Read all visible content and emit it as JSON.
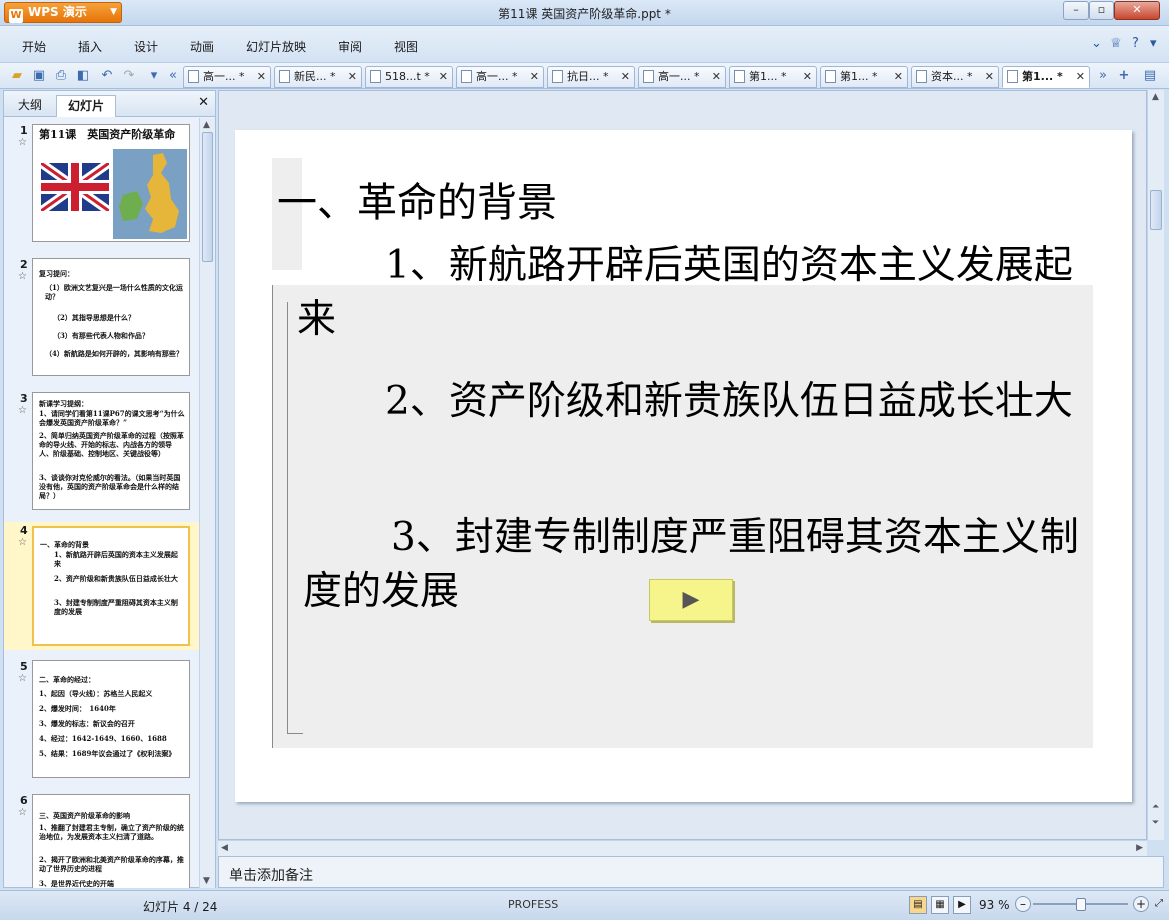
{
  "app": {
    "name": "WPS 演示",
    "logo_letter": "W"
  },
  "window": {
    "title": "第11课 英国资产阶级革命.ppt *"
  },
  "menu": [
    "开始",
    "插入",
    "设计",
    "动画",
    "幻灯片放映",
    "审阅",
    "视图"
  ],
  "tabs": [
    {
      "label": "高一... *",
      "active": false
    },
    {
      "label": "新民... *",
      "active": false
    },
    {
      "label": "518...t *",
      "active": false
    },
    {
      "label": "高一... *",
      "active": false
    },
    {
      "label": "抗日... *",
      "active": false
    },
    {
      "label": "高一... *",
      "active": false
    },
    {
      "label": "第1... *",
      "active": false
    },
    {
      "label": "第1... *",
      "active": false
    },
    {
      "label": "资本... *",
      "active": false
    },
    {
      "label": "第1... *",
      "active": true
    }
  ],
  "left_panel": {
    "tab_outline": "大纲",
    "tab_slides": "幻灯片",
    "thumbnails": [
      {
        "num": "1",
        "lines": [
          "第11课　英国资产阶级革命"
        ]
      },
      {
        "num": "2",
        "lines": [
          "复习提问：",
          "（1）欧洲文艺复兴是一场什么性质的文化运动？",
          "（2）其指导思想是什么？",
          "（3）有那些代表人物和作品？",
          "（4）新航路是如何开辟的，其影响有那些？"
        ]
      },
      {
        "num": "3",
        "lines": [
          "新课学习提纲：",
          "1、请同学们看第11课P67的课文思考“为什么会爆发英国资产阶级革命？”",
          "2、简单归纳英国资产阶级革命的过程（按照革命的导火线、开始的标志、内战各方的领导人、阶级基础、控制地区、关键战役等）",
          "3、谈谈你对克伦威尔的看法。（如果当时英国没有他，英国的资产阶级革命会是什么样的结局？）"
        ]
      },
      {
        "num": "4",
        "lines": [
          "一、革命的背景",
          "1、新航路开辟后英国的资本主义发展起来",
          "2、资产阶级和新贵族队伍日益成长壮大",
          "3、封建专制制度严重阻碍其资本主义制度的发展"
        ]
      },
      {
        "num": "5",
        "lines": [
          "二、革命的经过：",
          "1、起因（导火线）：苏格兰人民起义",
          "2、爆发时间：　1640年",
          "3、爆发的标志：新议会的召开",
          "4、经过：1642-1649、1660、1688",
          "5、结果：1689年议会通过了《权利法案》"
        ]
      },
      {
        "num": "6",
        "lines": [
          "三、英国资产阶级革命的影响",
          "1、推翻了封建君主专制，确立了资产阶级的统治地位，为发展资本主义扫清了道路。",
          "2、揭开了欧洲和北美资产阶级革命的序幕，推动了世界历史的进程",
          "3、是世界近代史的开端"
        ]
      }
    ]
  },
  "slide": {
    "heading": "一、革命的背景",
    "points": [
      "1、新航路开辟后英国的资本主义发展起来",
      "2、资产阶级和新贵族队伍日益成长壮大",
      "3、封建专制制度严重阻碍其资本主义制度的发展"
    ],
    "play_button": "▶"
  },
  "notes": {
    "placeholder": "单击添加备注"
  },
  "status": {
    "slide_counter": "幻灯片 4 / 24",
    "theme": "PROFESS",
    "zoom": "93 %",
    "zoom_level_fraction": 0.5
  },
  "colors": {
    "accent_orange": "#e67409",
    "selected_thumb": "#fff6c9",
    "play_button": "#f5f58c"
  }
}
